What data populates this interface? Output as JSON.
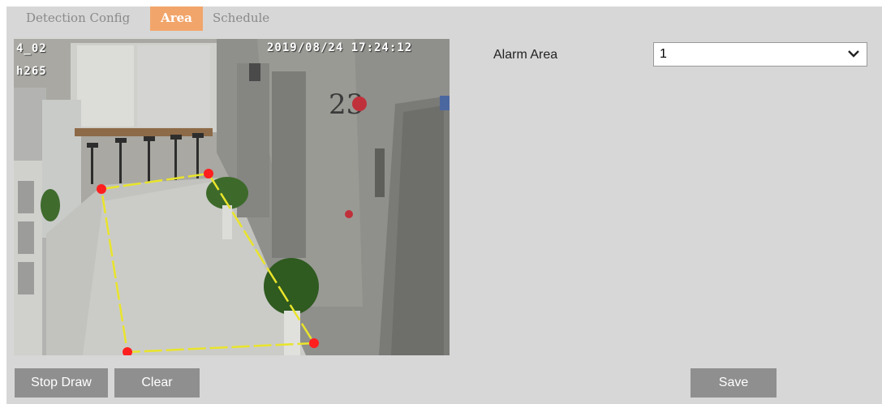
{
  "tabs": [
    {
      "label": "Detection Config"
    },
    {
      "label": "Area"
    },
    {
      "label": "Schedule"
    }
  ],
  "active_tab": "Area",
  "accent_color": "#f2a56a",
  "video": {
    "osd_channel": "4_02",
    "osd_resolution": "h265",
    "osd_timestamp": "2019/08/24 17:24:12",
    "wall_sign": "23"
  },
  "alarm_area": {
    "label": "Alarm Area",
    "value": "1"
  },
  "buttons": {
    "stop_draw": "Stop Draw",
    "clear": "Clear",
    "save": "Save"
  }
}
